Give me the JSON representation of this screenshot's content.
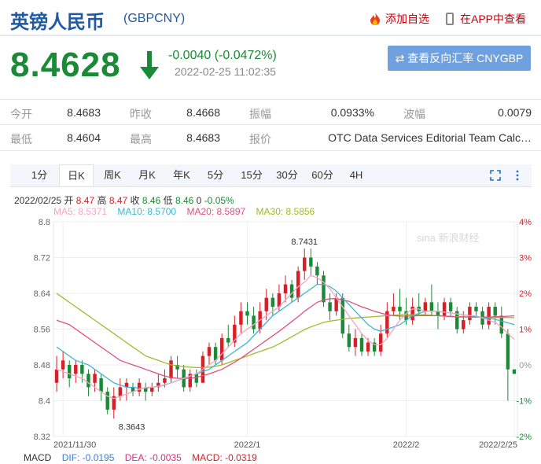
{
  "header": {
    "name": "英镑人民币",
    "code": "(GBPCNY)",
    "add_fav": "添加自选",
    "app_view": "在APP中查看"
  },
  "quote": {
    "price": "8.4628",
    "change": "-0.0040 (-0.0472%)",
    "timestamp": "2022-02-25 11:02:35",
    "reverse_button": "⇄ 查看反向汇率 CNYGBP"
  },
  "stats": {
    "row1": [
      {
        "label": "今开",
        "value": "8.4683"
      },
      {
        "label": "昨收",
        "value": "8.4668"
      },
      {
        "label": "振幅",
        "value": "0.0933%"
      },
      {
        "label": "波幅",
        "value": "0.0079"
      }
    ],
    "row2": [
      {
        "label": "最低",
        "value": "8.4604"
      },
      {
        "label": "最高",
        "value": "8.4683"
      },
      {
        "label": "报价",
        "value": "OTC Data Services Editorial Team Calc…"
      }
    ]
  },
  "tabs": [
    "1分",
    "日K",
    "周K",
    "月K",
    "年K",
    "5分",
    "15分",
    "30分",
    "60分",
    "4H"
  ],
  "active_tab": "日K",
  "ohlc_line": {
    "date": "2022/02/25",
    "open_label": "开",
    "open": "8.47",
    "high_label": "高",
    "high": "8.47",
    "close_label": "收",
    "close": "8.46",
    "low_label": "低",
    "low": "8.46",
    "vol": "0",
    "pct": "-0.05%"
  },
  "ma_legend": [
    {
      "label": "MA5: 8.5371",
      "color": "#f4a6c3"
    },
    {
      "label": "MA10: 8.5700",
      "color": "#3db5d6"
    },
    {
      "label": "MA20: 8.5897",
      "color": "#e0507a"
    },
    {
      "label": "MA30: 8.5856",
      "color": "#a3b82a"
    }
  ],
  "macd": {
    "label": "MACD",
    "dif": "DIF: -0.0195",
    "dea": "DEA: -0.0035",
    "macd": "MACD: -0.0319"
  },
  "colors": {
    "up": "#d61f26",
    "down": "#1b8a36",
    "brand": "#1f5aa6"
  },
  "chart_data": {
    "type": "candlestick",
    "y_ticks": [
      "8.8",
      "8.72",
      "8.64",
      "8.56",
      "8.48",
      "8.4",
      "8.32"
    ],
    "ylim": [
      8.32,
      8.8
    ],
    "right_ticks": [
      "4%",
      "3%",
      "2%",
      "1%",
      "0%",
      "-1%",
      "-2%"
    ],
    "x_labels": [
      "2021/11/30",
      "2022/1",
      "2022/2",
      "2022/2/25"
    ],
    "x_label_index": [
      1,
      30,
      55,
      72
    ],
    "annotations": {
      "max": "8.7431",
      "min": "8.3643"
    },
    "candles": [
      [
        8.44,
        8.47,
        8.5,
        8.42
      ],
      [
        8.47,
        8.49,
        8.51,
        8.45
      ],
      [
        8.48,
        8.45,
        8.49,
        8.43
      ],
      [
        8.46,
        8.48,
        8.49,
        8.44
      ],
      [
        8.48,
        8.46,
        8.49,
        8.44
      ],
      [
        8.46,
        8.43,
        8.47,
        8.41
      ],
      [
        8.44,
        8.46,
        8.47,
        8.42
      ],
      [
        8.45,
        8.42,
        8.46,
        8.4
      ],
      [
        8.42,
        8.38,
        8.43,
        8.37
      ],
      [
        8.38,
        8.41,
        8.43,
        8.36
      ],
      [
        8.41,
        8.43,
        8.45,
        8.4
      ],
      [
        8.43,
        8.44,
        8.45,
        8.4
      ],
      [
        8.43,
        8.42,
        8.44,
        8.41
      ],
      [
        8.42,
        8.44,
        8.45,
        8.41
      ],
      [
        8.43,
        8.42,
        8.44,
        8.4
      ],
      [
        8.42,
        8.43,
        8.44,
        8.41
      ],
      [
        8.43,
        8.44,
        8.46,
        8.42
      ],
      [
        8.44,
        8.45,
        8.47,
        8.43
      ],
      [
        8.45,
        8.49,
        8.5,
        8.44
      ],
      [
        8.48,
        8.47,
        8.5,
        8.45
      ],
      [
        8.47,
        8.43,
        8.48,
        8.42
      ],
      [
        8.43,
        8.46,
        8.47,
        8.42
      ],
      [
        8.46,
        8.44,
        8.47,
        8.43
      ],
      [
        8.44,
        8.5,
        8.51,
        8.44
      ],
      [
        8.5,
        8.52,
        8.53,
        8.48
      ],
      [
        8.52,
        8.49,
        8.53,
        8.48
      ],
      [
        8.49,
        8.54,
        8.55,
        8.48
      ],
      [
        8.54,
        8.53,
        8.57,
        8.52
      ],
      [
        8.53,
        8.57,
        8.59,
        8.52
      ],
      [
        8.57,
        8.6,
        8.62,
        8.55
      ],
      [
        8.6,
        8.59,
        8.62,
        8.57
      ],
      [
        8.59,
        8.56,
        8.61,
        8.55
      ],
      [
        8.56,
        8.6,
        8.62,
        8.55
      ],
      [
        8.6,
        8.63,
        8.65,
        8.58
      ],
      [
        8.63,
        8.61,
        8.64,
        8.59
      ],
      [
        8.61,
        8.64,
        8.66,
        8.6
      ],
      [
        8.64,
        8.66,
        8.68,
        8.62
      ],
      [
        8.66,
        8.63,
        8.67,
        8.62
      ],
      [
        8.63,
        8.69,
        8.7,
        8.62
      ],
      [
        8.69,
        8.72,
        8.74,
        8.67
      ],
      [
        8.72,
        8.7,
        8.74,
        8.68
      ],
      [
        8.7,
        8.68,
        8.71,
        8.66
      ],
      [
        8.68,
        8.62,
        8.69,
        8.61
      ],
      [
        8.62,
        8.6,
        8.64,
        8.58
      ],
      [
        8.6,
        8.63,
        8.64,
        8.59
      ],
      [
        8.63,
        8.55,
        8.64,
        8.54
      ],
      [
        8.55,
        8.52,
        8.57,
        8.51
      ],
      [
        8.52,
        8.54,
        8.56,
        8.5
      ],
      [
        8.54,
        8.51,
        8.55,
        8.5
      ],
      [
        8.51,
        8.53,
        8.54,
        8.5
      ],
      [
        8.53,
        8.51,
        8.54,
        8.5
      ],
      [
        8.51,
        8.55,
        8.57,
        8.5
      ],
      [
        8.55,
        8.6,
        8.62,
        8.54
      ],
      [
        8.6,
        8.61,
        8.64,
        8.59
      ],
      [
        8.61,
        8.6,
        8.65,
        8.58
      ],
      [
        8.6,
        8.58,
        8.63,
        8.57
      ],
      [
        8.58,
        8.61,
        8.63,
        8.57
      ],
      [
        8.61,
        8.6,
        8.64,
        8.59
      ],
      [
        8.6,
        8.62,
        8.63,
        8.59
      ],
      [
        8.62,
        8.6,
        8.66,
        8.59
      ],
      [
        8.6,
        8.59,
        8.62,
        8.56
      ],
      [
        8.59,
        8.62,
        8.63,
        8.58
      ],
      [
        8.62,
        8.6,
        8.63,
        8.59
      ],
      [
        8.6,
        8.56,
        8.61,
        8.55
      ],
      [
        8.56,
        8.58,
        8.6,
        8.55
      ],
      [
        8.58,
        8.61,
        8.62,
        8.57
      ],
      [
        8.61,
        8.6,
        8.62,
        8.59
      ],
      [
        8.6,
        8.57,
        8.61,
        8.56
      ],
      [
        8.57,
        8.61,
        8.62,
        8.56
      ],
      [
        8.61,
        8.59,
        8.62,
        8.57
      ],
      [
        8.59,
        8.55,
        8.61,
        8.54
      ],
      [
        8.55,
        8.47,
        8.56,
        8.4
      ],
      [
        8.47,
        8.46,
        8.47,
        8.46
      ]
    ],
    "ma": {
      "MA30": [
        8.64,
        8.63,
        8.62,
        8.61,
        8.6,
        8.59,
        8.58,
        8.57,
        8.56,
        8.55,
        8.54,
        8.53,
        8.52,
        8.51,
        8.5,
        8.495,
        8.49,
        8.485,
        8.48,
        8.478,
        8.476,
        8.475,
        8.474,
        8.474,
        8.475,
        8.477,
        8.48,
        8.485,
        8.49,
        8.495,
        8.5,
        8.505,
        8.51,
        8.515,
        8.52,
        8.527,
        8.535,
        8.543,
        8.551,
        8.559,
        8.565,
        8.57,
        8.575,
        8.578,
        8.58,
        8.582,
        8.584,
        8.585,
        8.586,
        8.587,
        8.588,
        8.589,
        8.59,
        8.591,
        8.592,
        8.592,
        8.592,
        8.592,
        8.592,
        8.591,
        8.59,
        8.589,
        8.589,
        8.588,
        8.588,
        8.587,
        8.587,
        8.587,
        8.586,
        8.586,
        8.586,
        8.586,
        8.5856
      ],
      "MA20": [
        8.58,
        8.575,
        8.57,
        8.56,
        8.55,
        8.54,
        8.53,
        8.52,
        8.51,
        8.5,
        8.49,
        8.485,
        8.48,
        8.475,
        8.47,
        8.465,
        8.46,
        8.455,
        8.452,
        8.45,
        8.45,
        8.45,
        8.452,
        8.456,
        8.46,
        8.465,
        8.47,
        8.478,
        8.486,
        8.495,
        8.505,
        8.515,
        8.525,
        8.535,
        8.545,
        8.555,
        8.566,
        8.577,
        8.588,
        8.6,
        8.61,
        8.62,
        8.625,
        8.628,
        8.628,
        8.626,
        8.622,
        8.616,
        8.61,
        8.605,
        8.6,
        8.596,
        8.592,
        8.59,
        8.589,
        8.589,
        8.589,
        8.59,
        8.59,
        8.59,
        8.59,
        8.589,
        8.588,
        8.587,
        8.587,
        8.587,
        8.587,
        8.587,
        8.587,
        8.588,
        8.588,
        8.589,
        8.5897
      ],
      "MA10": [
        8.52,
        8.51,
        8.5,
        8.49,
        8.485,
        8.48,
        8.47,
        8.46,
        8.45,
        8.44,
        8.435,
        8.43,
        8.43,
        8.428,
        8.428,
        8.43,
        8.432,
        8.435,
        8.44,
        8.445,
        8.45,
        8.455,
        8.46,
        8.465,
        8.47,
        8.48,
        8.49,
        8.5,
        8.51,
        8.52,
        8.53,
        8.545,
        8.56,
        8.575,
        8.59,
        8.6,
        8.61,
        8.62,
        8.63,
        8.64,
        8.65,
        8.66,
        8.66,
        8.655,
        8.645,
        8.63,
        8.615,
        8.6,
        8.585,
        8.57,
        8.56,
        8.555,
        8.56,
        8.565,
        8.57,
        8.58,
        8.59,
        8.595,
        8.6,
        8.6,
        8.6,
        8.598,
        8.596,
        8.594,
        8.592,
        8.59,
        8.588,
        8.586,
        8.584,
        8.582,
        8.578,
        8.574,
        8.57
      ],
      "MA5": [
        8.47,
        8.465,
        8.46,
        8.455,
        8.45,
        8.44,
        8.43,
        8.42,
        8.41,
        8.405,
        8.41,
        8.415,
        8.42,
        8.425,
        8.43,
        8.43,
        8.432,
        8.436,
        8.44,
        8.445,
        8.45,
        8.455,
        8.46,
        8.47,
        8.48,
        8.49,
        8.505,
        8.52,
        8.535,
        8.55,
        8.56,
        8.57,
        8.58,
        8.59,
        8.6,
        8.61,
        8.625,
        8.64,
        8.655,
        8.665,
        8.68,
        8.675,
        8.665,
        8.65,
        8.63,
        8.61,
        8.59,
        8.57,
        8.55,
        8.535,
        8.525,
        8.525,
        8.54,
        8.56,
        8.58,
        8.595,
        8.605,
        8.605,
        8.6,
        8.6,
        8.6,
        8.598,
        8.596,
        8.594,
        8.592,
        8.59,
        8.59,
        8.585,
        8.58,
        8.575,
        8.565,
        8.55,
        8.5371
      ]
    }
  }
}
